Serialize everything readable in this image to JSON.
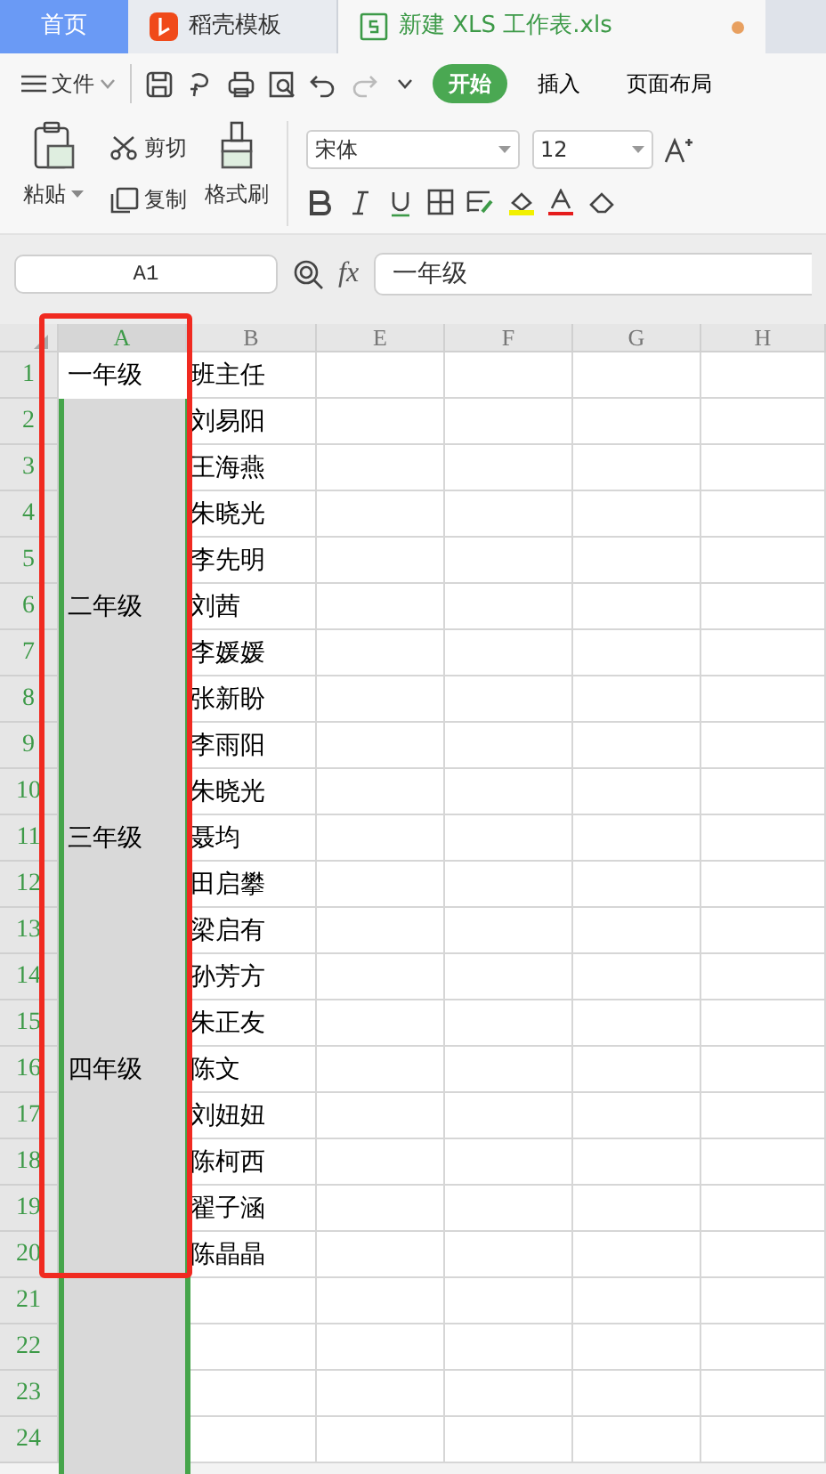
{
  "tabs": [
    {
      "kind": "home",
      "label": "首页",
      "selected": false
    },
    {
      "kind": "template",
      "label": "稻壳模板",
      "selected": false
    },
    {
      "kind": "sheet",
      "label": "新建 XLS 工作表.xls",
      "selected": true,
      "modified": true
    }
  ],
  "menu": {
    "file_label": "文件",
    "ribbon_tabs": [
      {
        "label": "开始",
        "selected": true
      },
      {
        "label": "插入",
        "selected": false
      },
      {
        "label": "页面布局",
        "selected": false
      }
    ]
  },
  "ribbon": {
    "paste": "粘贴",
    "cut": "剪切",
    "copy": "复制",
    "format_painter": "格式刷",
    "font": "宋体",
    "font_size": "12"
  },
  "formula_bar": {
    "name_box": "A1",
    "fx": "fx",
    "value": "一年级"
  },
  "sheet": {
    "columns": [
      {
        "label": "A",
        "selected": true
      },
      {
        "label": "B",
        "selected": false
      },
      {
        "label": "E",
        "selected": false
      },
      {
        "label": "F",
        "selected": false
      },
      {
        "label": "G",
        "selected": false
      },
      {
        "label": "H",
        "selected": false
      }
    ],
    "annotation": {
      "kind": "frame"
    },
    "rows": [
      {
        "number": "1",
        "cells": [
          "一年级",
          "班主任"
        ],
        "active": true
      },
      {
        "number": "2",
        "cells": [
          "",
          "刘易阳"
        ],
        "active": false
      },
      {
        "number": "3",
        "cells": [
          "",
          "王海燕"
        ],
        "active": false
      },
      {
        "number": "4",
        "cells": [
          "",
          "朱晓光"
        ],
        "active": false
      },
      {
        "number": "5",
        "cells": [
          "",
          "李先明"
        ],
        "active": false
      },
      {
        "number": "6",
        "cells": [
          "二年级",
          "刘茜"
        ],
        "active": false
      },
      {
        "number": "7",
        "cells": [
          "",
          "李媛媛"
        ],
        "active": false
      },
      {
        "number": "8",
        "cells": [
          "",
          "张新盼"
        ],
        "active": false
      },
      {
        "number": "9",
        "cells": [
          "",
          "李雨阳"
        ],
        "active": false
      },
      {
        "number": "10",
        "cells": [
          "",
          "朱晓光"
        ],
        "active": false
      },
      {
        "number": "11",
        "cells": [
          "三年级",
          "聂均"
        ],
        "active": false
      },
      {
        "number": "12",
        "cells": [
          "",
          "田启攀"
        ],
        "active": false
      },
      {
        "number": "13",
        "cells": [
          "",
          "梁启有"
        ],
        "active": false
      },
      {
        "number": "14",
        "cells": [
          "",
          "孙芳方"
        ],
        "active": false
      },
      {
        "number": "15",
        "cells": [
          "",
          "朱正友"
        ],
        "active": false
      },
      {
        "number": "16",
        "cells": [
          "四年级",
          "陈文"
        ],
        "active": false
      },
      {
        "number": "17",
        "cells": [
          "",
          "刘妞妞"
        ],
        "active": false
      },
      {
        "number": "18",
        "cells": [
          "",
          "陈柯西"
        ],
        "active": false
      },
      {
        "number": "19",
        "cells": [
          "",
          "翟子涵"
        ],
        "active": false
      },
      {
        "number": "20",
        "cells": [
          "",
          "陈晶晶"
        ],
        "active": false
      },
      {
        "number": "21",
        "cells": [
          "",
          ""
        ],
        "active": false
      },
      {
        "number": "22",
        "cells": [
          "",
          ""
        ],
        "active": false
      },
      {
        "number": "23",
        "cells": [
          "",
          ""
        ],
        "active": false
      },
      {
        "number": "24",
        "cells": [
          "",
          ""
        ],
        "active": false
      }
    ]
  }
}
